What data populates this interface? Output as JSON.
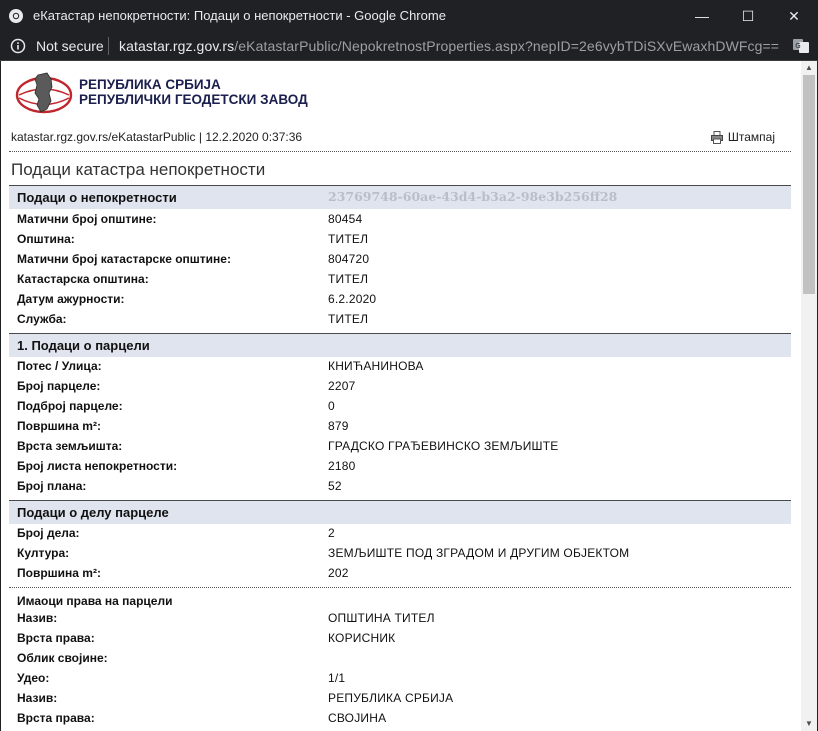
{
  "window": {
    "title": "еКатастар непокретности: Подаци о непокретности - Google Chrome",
    "minimize_glyph": "—",
    "maximize_glyph": "☐",
    "close_glyph": "✕"
  },
  "address_bar": {
    "security_label": "Not secure",
    "url_host": "katastar.rgz.gov.rs",
    "url_path": "/eKatastarPublic/NepokretnostProperties.aspx?nepID=2e6vybTDiSXvEwaxhDWFcg=="
  },
  "header": {
    "org_line1": "РЕПУБЛИКА СРБИЈА",
    "org_line2": "РЕПУБЛИЧКИ ГЕОДЕТСКИ ЗАВОД",
    "meta": "katastar.rgz.gov.rs/eKatastarPublic | 12.2.2020 0:37:36",
    "print_label": "Штампај",
    "page_title": "Подаци катастра непокретности"
  },
  "property": {
    "title": "Подаци о непокретности",
    "guid": "23769748-60ae-43d4-b3a2-98e3b256ff28",
    "rows": [
      {
        "k": "Матични број општине:",
        "v": "80454"
      },
      {
        "k": "Општина:",
        "v": "ТИТЕЛ"
      },
      {
        "k": "Матични број катастарске општине:",
        "v": "804720"
      },
      {
        "k": "Катастарска општина:",
        "v": "ТИТЕЛ"
      },
      {
        "k": "Датум ажурности:",
        "v": "6.2.2020"
      },
      {
        "k": "Служба:",
        "v": "ТИТЕЛ"
      }
    ]
  },
  "parcel": {
    "title": "1. Подаци о парцели",
    "rows": [
      {
        "k": "Потес / Улица:",
        "v": "КНИЋАНИНОВА"
      },
      {
        "k": "Број парцеле:",
        "v": "2207"
      },
      {
        "k": "Подброј парцеле:",
        "v": "0"
      },
      {
        "k": "Површина m²:",
        "v": "879"
      },
      {
        "k": "Врста земљишта:",
        "v": "ГРАДСКО ГРАЂЕВИНСКО ЗЕМЉИШТЕ"
      },
      {
        "k": "Број листа непокретности:",
        "v": "2180"
      },
      {
        "k": "Број плана:",
        "v": "52"
      }
    ]
  },
  "part": {
    "title": "Подаци о делу парцеле",
    "rows": [
      {
        "k": "Број дела:",
        "v": "2"
      },
      {
        "k": "Култура:",
        "v": "ЗЕМЉИШТЕ ПОД ЗГРАДОМ И ДРУГИМ ОБЈЕКТОМ"
      },
      {
        "k": "Површина m²:",
        "v": "202"
      }
    ]
  },
  "owners": {
    "title": "Имаоци права на парцели",
    "rows": [
      {
        "k": "Назив:",
        "v": "ОПШТИНА ТИТЕЛ"
      },
      {
        "k": "Врста права:",
        "v": "КОРИСНИК"
      },
      {
        "k": "Облик својине:",
        "v": ""
      },
      {
        "k": "Удео:",
        "v": "1/1"
      },
      {
        "k": "Назив:",
        "v": "РЕПУБЛИКА СРБИЈА"
      },
      {
        "k": "Врста права:",
        "v": "СВОЈИНА"
      }
    ]
  },
  "colors": {
    "section_bg": "#dfe4ee",
    "logo_red": "#c0272d",
    "logo_navy": "#1a1f4d"
  }
}
